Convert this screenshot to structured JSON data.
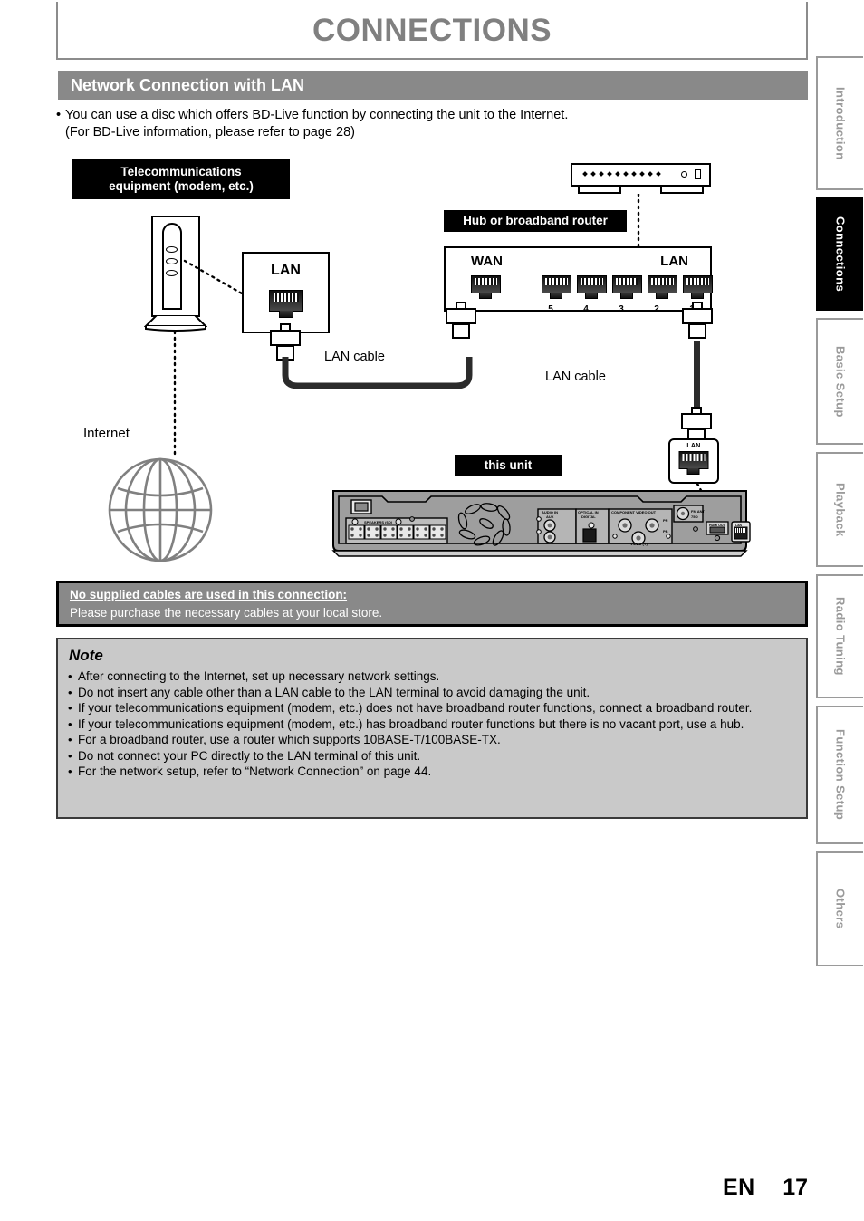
{
  "header": {
    "chapter_title": "CONNECTIONS",
    "section_title": "Network Connection with LAN"
  },
  "intro": {
    "bullet_line1": "You can use a disc which offers BD-Live function by connecting the unit to the Internet.",
    "bullet_line2": "(For BD-Live information, please refer to page 28)"
  },
  "diagram": {
    "telecom_label_line1": "Telecommunications",
    "telecom_label_line2": "equipment (modem, etc.)",
    "hub_label": "Hub or broadband router",
    "this_unit_label": "this unit",
    "modem_port_label": "LAN",
    "router_wan_label": "WAN",
    "router_lan_label": "LAN",
    "router_port_numbers": [
      "5",
      "4",
      "3",
      "2",
      "1"
    ],
    "cable_label_left": "LAN cable",
    "cable_label_right": "LAN cable",
    "internet_label": "Internet",
    "unit_terminal_label": "LAN"
  },
  "warning": {
    "heading": "No supplied cables are used in this connection:",
    "body": "Please purchase the necessary cables at your local store."
  },
  "note": {
    "title": "Note",
    "items": [
      "After connecting to the Internet, set up necessary network settings.",
      "Do not insert any cable other than a LAN cable to the LAN terminal to avoid damaging the unit.",
      "If your telecommunications equipment (modem, etc.) does not have broadband router functions, connect a broadband router.",
      "If your telecommunications equipment (modem, etc.) has broadband router functions but there is no vacant port, use a hub.",
      "For a broadband router, use a router which supports 10BASE-T/100BASE-TX.",
      "Do not connect your PC directly to the LAN terminal of this unit.",
      "For the network setup, refer to “Network Connection” on page 44."
    ]
  },
  "side_tabs": [
    {
      "label": "Introduction",
      "active": false
    },
    {
      "label": "Connections",
      "active": true
    },
    {
      "label": "Basic Setup",
      "active": false
    },
    {
      "label": "Playback",
      "active": false
    },
    {
      "label": "Radio Tuning",
      "active": false
    },
    {
      "label": "Function Setup",
      "active": false
    },
    {
      "label": "Others",
      "active": false
    }
  ],
  "footer": {
    "language": "EN",
    "page_number": "17"
  },
  "colors": {
    "section_bar": "#898989",
    "title_text": "#808080",
    "note_bg": "#c9c9c9",
    "warning_bg": "#898989",
    "tab_inactive": "#9a9a9a",
    "tab_active_bg": "#000000"
  }
}
